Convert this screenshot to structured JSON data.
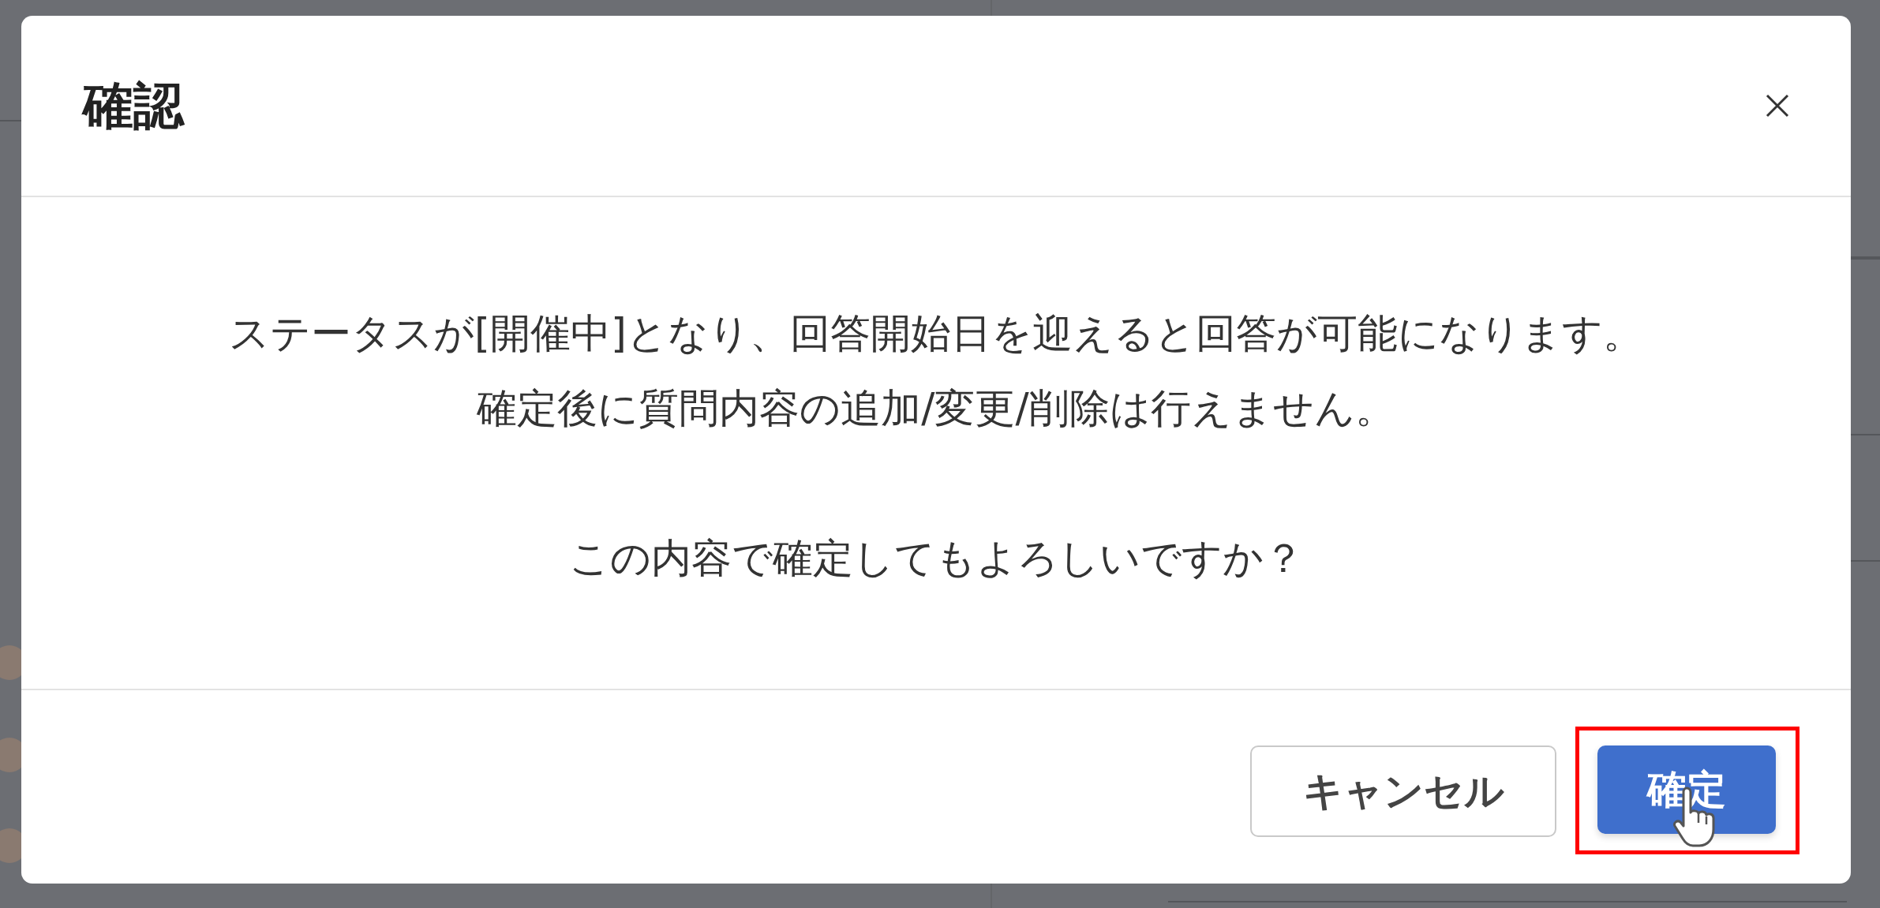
{
  "dialog": {
    "title": "確認",
    "paragraphs": [
      {
        "lines": [
          "ステータスが[開催中]となり、回答開始日を迎えると回答が可能になります。",
          "確定後に質問内容の追加/変更/削除は行えません。"
        ]
      },
      {
        "lines": [
          "この内容で確定してもよろしいですか？"
        ]
      }
    ],
    "buttons": [
      {
        "label": "キャンセル",
        "kind": "secondary",
        "highlighted": false
      },
      {
        "label": "確定",
        "kind": "primary",
        "highlighted": true
      }
    ]
  }
}
